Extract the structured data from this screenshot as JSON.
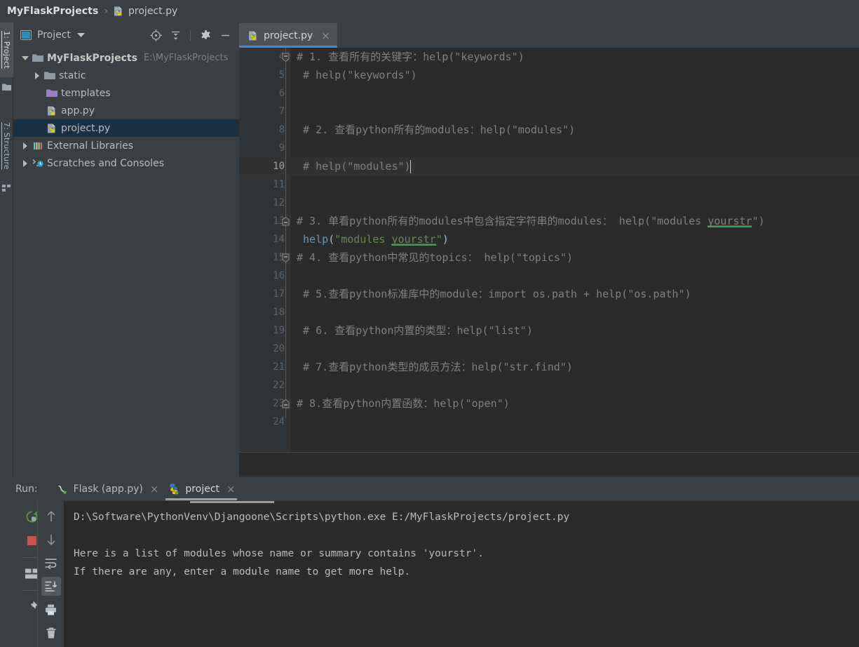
{
  "breadcrumb": {
    "root": "MyFlaskProjects",
    "separator": "›",
    "file": "project.py",
    "file_icon": "python-file-icon"
  },
  "left_strip": {
    "tabs": [
      {
        "label": "1: Project",
        "selected": true,
        "icon": "project-tab-icon"
      },
      {
        "label": "7: Structure",
        "selected": false,
        "icon": "structure-tab-icon"
      }
    ]
  },
  "project_panel": {
    "title": "Project",
    "title_icon": "project-window-icon",
    "caret_icon": "chevron-down-icon",
    "tools": [
      {
        "name": "locate-icon",
        "label": "Select Opened File"
      },
      {
        "name": "collapse-all-icon",
        "label": "Collapse All"
      },
      {
        "name": "gear-icon",
        "label": "Settings"
      },
      {
        "name": "minimize-icon",
        "label": "Hide"
      }
    ],
    "tree": [
      {
        "label": "MyFlaskProjects",
        "path": "E:\\MyFlaskProjects",
        "icon": "folder-icon",
        "twisty": "expanded",
        "indent": 0,
        "bold": true,
        "selected": false
      },
      {
        "label": "static",
        "path": "",
        "icon": "folder-icon",
        "twisty": "collapsed",
        "indent": 1,
        "bold": false,
        "selected": false
      },
      {
        "label": "templates",
        "path": "",
        "icon": "folder-purple-icon",
        "twisty": "none",
        "indent": 1,
        "bold": false,
        "selected": false
      },
      {
        "label": "app.py",
        "path": "",
        "icon": "python-file-icon",
        "twisty": "none",
        "indent": 1,
        "bold": false,
        "selected": false
      },
      {
        "label": "project.py",
        "path": "",
        "icon": "python-file-icon",
        "twisty": "none",
        "indent": 1,
        "bold": false,
        "selected": true
      },
      {
        "label": "External Libraries",
        "path": "",
        "icon": "libraries-icon",
        "twisty": "collapsed",
        "indent": 0,
        "bold": false,
        "selected": false
      },
      {
        "label": "Scratches and Consoles",
        "path": "",
        "icon": "scratches-icon",
        "twisty": "collapsed",
        "indent": 0,
        "bold": false,
        "selected": false
      }
    ]
  },
  "editor": {
    "tab": {
      "label": "project.py",
      "icon": "python-file-icon",
      "close": "×",
      "active": true
    },
    "current_line": 10,
    "lines": [
      {
        "num": 4,
        "fold": "fold-end-down",
        "segments": [
          {
            "t": "# 1. 查看所有的关键字：help(\"keywords\")",
            "c": "cmt"
          }
        ]
      },
      {
        "num": 5,
        "fold": "none",
        "segments": [
          {
            "t": " # help(\"keywords\")",
            "c": "cmt"
          }
        ]
      },
      {
        "num": 6,
        "fold": "none",
        "segments": []
      },
      {
        "num": 7,
        "fold": "none",
        "segments": []
      },
      {
        "num": 8,
        "fold": "none",
        "segments": [
          {
            "t": " # 2. 查看python所有的modules：help(\"modules\")",
            "c": "cmt"
          }
        ]
      },
      {
        "num": 9,
        "fold": "none",
        "segments": []
      },
      {
        "num": 10,
        "fold": "none",
        "caret": true,
        "segments": [
          {
            "t": " # help(\"modules\")",
            "c": "cmt"
          }
        ]
      },
      {
        "num": 11,
        "fold": "none",
        "segments": []
      },
      {
        "num": 12,
        "fold": "none",
        "segments": []
      },
      {
        "num": 13,
        "fold": "fold-start-up",
        "segments": [
          {
            "t": "# 3. 单看python所有的modules中包含指定字符串的modules： help(\"modules ",
            "c": "cmt"
          },
          {
            "t": "yourstr",
            "c": "cmt typo"
          },
          {
            "t": "\")",
            "c": "cmt"
          }
        ]
      },
      {
        "num": 14,
        "fold": "none",
        "segments": [
          {
            "t": " help",
            "c": "fn"
          },
          {
            "t": "(",
            "c": "pun"
          },
          {
            "t": "\"modules ",
            "c": "str"
          },
          {
            "t": "yourstr",
            "c": "str typo"
          },
          {
            "t": "\"",
            "c": "str"
          },
          {
            "t": ")",
            "c": "pun"
          }
        ]
      },
      {
        "num": 15,
        "fold": "fold-end-down",
        "segments": [
          {
            "t": "# 4. 查看python中常见的topics： help(\"topics\")",
            "c": "cmt"
          }
        ]
      },
      {
        "num": 16,
        "fold": "none",
        "segments": []
      },
      {
        "num": 17,
        "fold": "none",
        "segments": [
          {
            "t": " # 5.查看python标准库中的module：import os.path + help(\"os.path\")",
            "c": "cmt"
          }
        ]
      },
      {
        "num": 18,
        "fold": "none",
        "segments": []
      },
      {
        "num": 19,
        "fold": "none",
        "segments": [
          {
            "t": " # 6. 查看python内置的类型：help(\"list\")",
            "c": "cmt"
          }
        ]
      },
      {
        "num": 20,
        "fold": "none",
        "segments": []
      },
      {
        "num": 21,
        "fold": "none",
        "segments": [
          {
            "t": " # 7.查看python类型的成员方法：help(\"str.find\")",
            "c": "cmt"
          }
        ]
      },
      {
        "num": 22,
        "fold": "none",
        "segments": []
      },
      {
        "num": 23,
        "fold": "fold-start-up",
        "segments": [
          {
            "t": "# 8.查看python内置函数：help(\"open\")",
            "c": "cmt"
          }
        ]
      },
      {
        "num": 24,
        "fold": "none",
        "segments": []
      }
    ]
  },
  "run_panel": {
    "label": "Run:",
    "tabs": [
      {
        "name": "Flask (app.py)",
        "icon": "flask-icon",
        "close": "×",
        "active": false
      },
      {
        "name": "project",
        "icon": "python-run-icon",
        "close": "×",
        "active": true
      }
    ],
    "toolbar_left": [
      {
        "name": "rerun-icon",
        "label": "Rerun"
      },
      {
        "name": "stop-icon",
        "label": "Stop"
      },
      {
        "name": "restore-layout-icon",
        "label": "Restore Layout"
      },
      {
        "name": "pin-icon",
        "label": "Pin Tab"
      }
    ],
    "toolbar_right": [
      {
        "name": "up-arrow-icon",
        "label": "Up the Stack Trace"
      },
      {
        "name": "down-arrow-icon",
        "label": "Down the Stack Trace"
      },
      {
        "name": "soft-wrap-icon",
        "label": "Use Soft Wraps"
      },
      {
        "name": "scroll-to-end-icon",
        "label": "Scroll to End",
        "active": true
      },
      {
        "name": "print-icon",
        "label": "Print"
      },
      {
        "name": "trash-icon",
        "label": "Clear All"
      }
    ],
    "console": [
      "D:\\Software\\PythonVenv\\Djangoone\\Scripts\\python.exe E:/MyFlaskProjects/project.py",
      "",
      "Here is a list of modules whose name or summary contains 'yourstr'.",
      "If there are any, enter a module name to get more help."
    ]
  },
  "colors": {
    "panel_bg": "#3c3f41",
    "editor_bg": "#2b2b2b",
    "gutter_bg": "#313335",
    "tab_active": "#4e5254",
    "accent_blue": "#4a88c7",
    "comment": "#808080",
    "string": "#6a8759",
    "function": "#6897bb",
    "selection": "#1b3043",
    "typo_underline": "#4e9a5c"
  }
}
